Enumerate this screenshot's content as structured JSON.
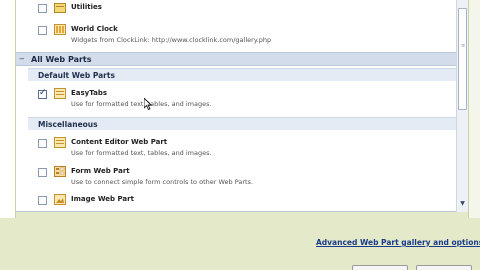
{
  "items_top": [
    {
      "title": "Utilities",
      "description": "",
      "checked": false,
      "icon": "folder-icon"
    },
    {
      "title": "World Clock",
      "description": "Widgets from ClockLink: http://www.clocklink.com/gallery.php",
      "checked": false,
      "icon": "webpart-icon"
    }
  ],
  "all_web_parts": {
    "label": "All Web Parts",
    "toggle": "−"
  },
  "categories": [
    {
      "header": "Default Web Parts",
      "items": [
        {
          "title": "EasyTabs",
          "description": "Use for formatted text, tables, and images.",
          "checked": true,
          "icon": "webpart-icon"
        }
      ]
    },
    {
      "header": "Miscellaneous",
      "items": [
        {
          "title": "Content Editor Web Part",
          "description": "Use for formatted text, tables, and images.",
          "checked": false,
          "icon": "webpart-icon"
        },
        {
          "title": "Form Web Part",
          "description": "Use to connect simple form controls to other Web Parts.",
          "checked": false,
          "icon": "form-icon"
        },
        {
          "title": "Image Web Part",
          "description": "",
          "checked": false,
          "icon": "image-icon"
        }
      ]
    }
  ],
  "footer": {
    "gallery_link": "Advanced Web Part gallery and options"
  },
  "colors": {
    "header_blue": "#d2dcea",
    "link": "#1a3b8a",
    "background": "#e3e9c9"
  }
}
